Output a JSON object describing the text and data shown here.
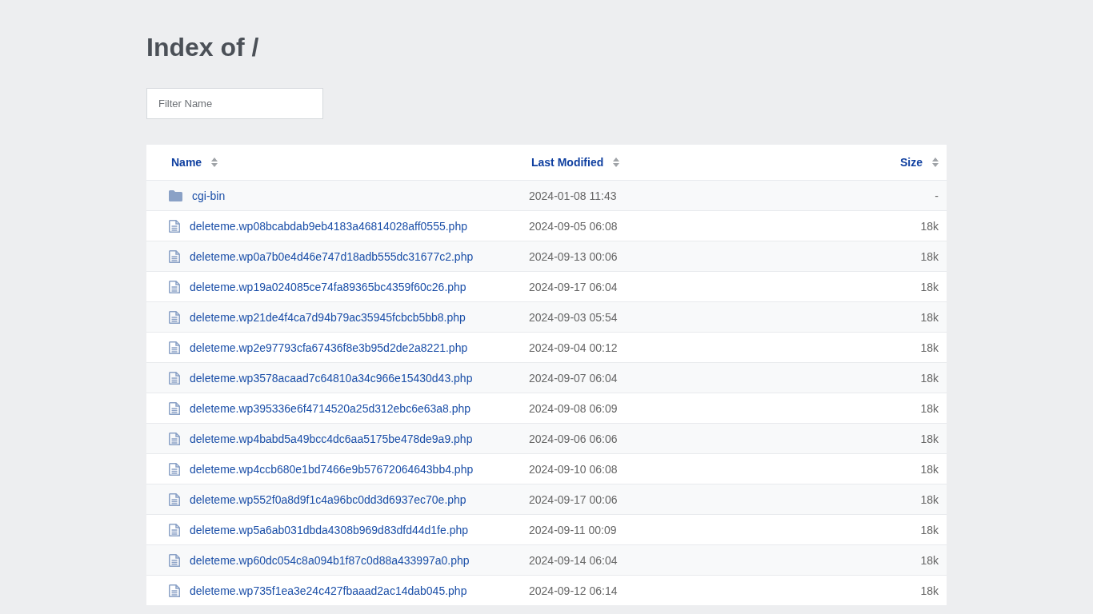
{
  "title": "Index of /",
  "filter": {
    "placeholder": "Filter Name"
  },
  "columns": [
    {
      "label": "Name"
    },
    {
      "label": "Last Modified"
    },
    {
      "label": "Size"
    }
  ],
  "rows": [
    {
      "kind": "folder",
      "name": "cgi-bin",
      "modified": "2024-01-08 11:43",
      "size": "-"
    },
    {
      "kind": "file",
      "name": "deleteme.wp08bcabdab9eb4183a46814028aff0555.php",
      "modified": "2024-09-05 06:08",
      "size": "18k"
    },
    {
      "kind": "file",
      "name": "deleteme.wp0a7b0e4d46e747d18adb555dc31677c2.php",
      "modified": "2024-09-13 00:06",
      "size": "18k"
    },
    {
      "kind": "file",
      "name": "deleteme.wp19a024085ce74fa89365bc4359f60c26.php",
      "modified": "2024-09-17 06:04",
      "size": "18k"
    },
    {
      "kind": "file",
      "name": "deleteme.wp21de4f4ca7d94b79ac35945fcbcb5bb8.php",
      "modified": "2024-09-03 05:54",
      "size": "18k"
    },
    {
      "kind": "file",
      "name": "deleteme.wp2e97793cfa67436f8e3b95d2de2a8221.php",
      "modified": "2024-09-04 00:12",
      "size": "18k"
    },
    {
      "kind": "file",
      "name": "deleteme.wp3578acaad7c64810a34c966e15430d43.php",
      "modified": "2024-09-07 06:04",
      "size": "18k"
    },
    {
      "kind": "file",
      "name": "deleteme.wp395336e6f4714520a25d312ebc6e63a8.php",
      "modified": "2024-09-08 06:09",
      "size": "18k"
    },
    {
      "kind": "file",
      "name": "deleteme.wp4babd5a49bcc4dc6aa5175be478de9a9.php",
      "modified": "2024-09-06 06:06",
      "size": "18k"
    },
    {
      "kind": "file",
      "name": "deleteme.wp4ccb680e1bd7466e9b57672064643bb4.php",
      "modified": "2024-09-10 06:08",
      "size": "18k"
    },
    {
      "kind": "file",
      "name": "deleteme.wp552f0a8d9f1c4a96bc0dd3d6937ec70e.php",
      "modified": "2024-09-17 00:06",
      "size": "18k"
    },
    {
      "kind": "file",
      "name": "deleteme.wp5a6ab031dbda4308b969d83dfd44d1fe.php",
      "modified": "2024-09-11 00:09",
      "size": "18k"
    },
    {
      "kind": "file",
      "name": "deleteme.wp60dc054c8a094b1f87c0d88a433997a0.php",
      "modified": "2024-09-14 06:04",
      "size": "18k"
    },
    {
      "kind": "file",
      "name": "deleteme.wp735f1ea3e24c427fbaaad2ac14dab045.php",
      "modified": "2024-09-12 06:14",
      "size": "18k"
    }
  ]
}
